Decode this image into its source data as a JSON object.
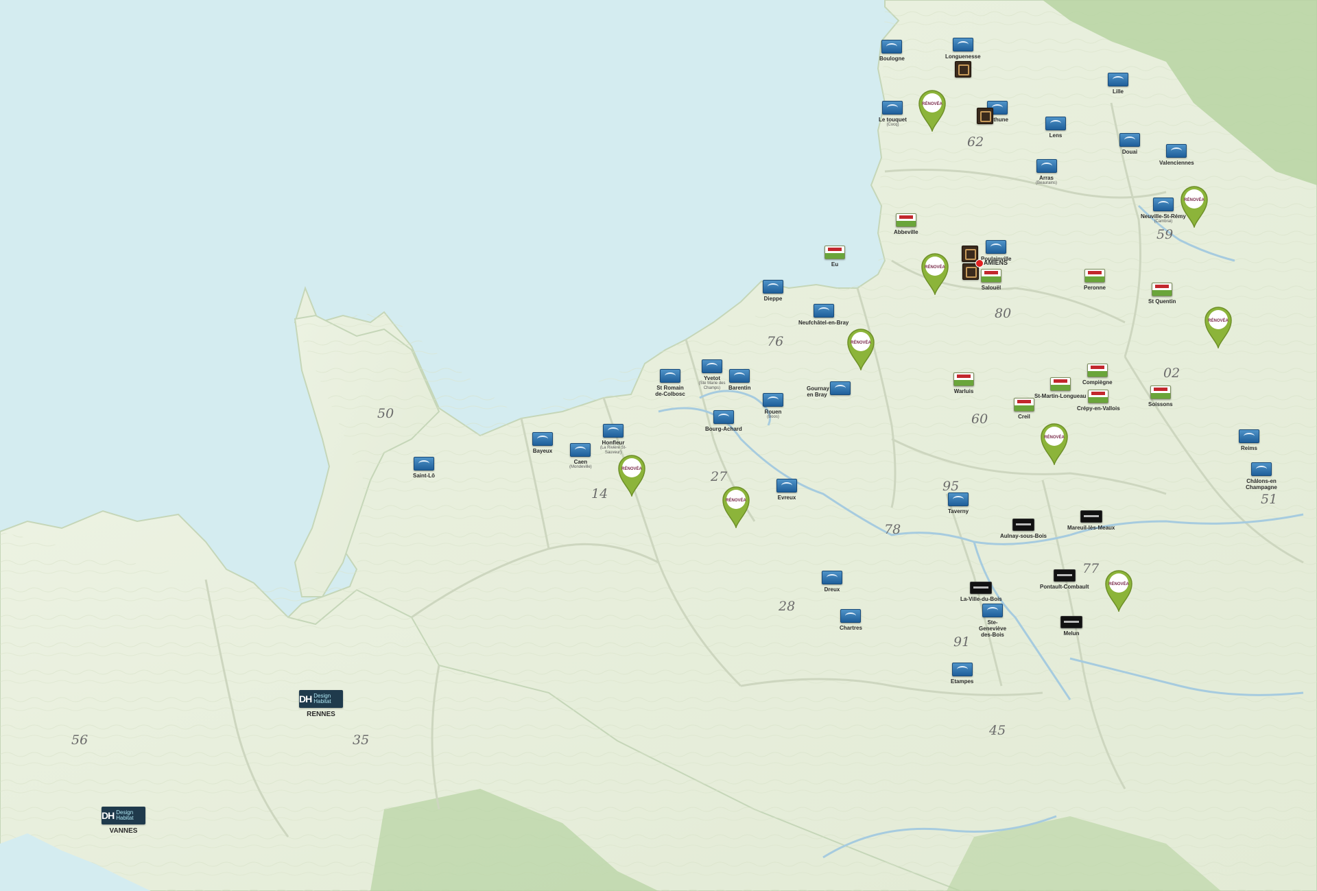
{
  "colors": {
    "sea": "#d4ecf0",
    "land": "#e7efdc",
    "land_shade": "#d9e4c9",
    "border": "#c9d3b9",
    "river": "#a6cbdf",
    "forest": "#b7d3a2",
    "pin_green": "#8cb43a",
    "dh_blue": "#1f3a4c",
    "amiens_red": "#e02020"
  },
  "departments": [
    "62",
    "59",
    "80",
    "02",
    "76",
    "60",
    "50",
    "14",
    "27",
    "95",
    "78",
    "77",
    "51",
    "28",
    "91",
    "56",
    "35",
    "45"
  ],
  "markers": [
    {
      "city": "Boulogne",
      "icon": "blue-house-badge-icon",
      "sub": ""
    },
    {
      "city": "Longuenesse",
      "icon": "blue-house-badge-icon",
      "sub": ""
    },
    {
      "city": "Lille",
      "icon": "blue-house-badge-icon",
      "sub": ""
    },
    {
      "city": "Le touquet",
      "icon": "blue-house-badge-icon",
      "sub": "(Cucq)"
    },
    {
      "city": "Bethune",
      "icon": "blue-house-badge-icon",
      "sub": ""
    },
    {
      "city": "Lens",
      "icon": "blue-house-badge-icon",
      "sub": ""
    },
    {
      "city": "Douai",
      "icon": "blue-house-badge-icon",
      "sub": ""
    },
    {
      "city": "Valenciennes",
      "icon": "blue-house-badge-icon",
      "sub": ""
    },
    {
      "city": "Arras",
      "icon": "blue-house-badge-icon",
      "sub": "(Beaurains)"
    },
    {
      "city": "Neuville-St-Rémy",
      "icon": "blue-house-badge-icon",
      "sub": "(Cambrai)"
    },
    {
      "city": "Abbeville",
      "icon": "green-picardie-badge-icon",
      "sub": ""
    },
    {
      "city": "Eu",
      "icon": "green-picardie-badge-icon",
      "sub": ""
    },
    {
      "city": "Poulainville",
      "icon": "blue-house-badge-icon",
      "sub": ""
    },
    {
      "city": "Salouël",
      "icon": "green-picardie-badge-icon",
      "sub": ""
    },
    {
      "city": "Peronne",
      "icon": "green-picardie-badge-icon",
      "sub": ""
    },
    {
      "city": "St Quentin",
      "icon": "green-picardie-badge-icon",
      "sub": ""
    },
    {
      "city": "Dieppe",
      "icon": "blue-house-badge-icon",
      "sub": ""
    },
    {
      "city": "Neufchâtel-en-Bray",
      "icon": "blue-house-badge-icon",
      "sub": ""
    },
    {
      "city": "St Romain de-Colbosc",
      "icon": "blue-house-badge-icon",
      "sub": ""
    },
    {
      "city": "Yvetot",
      "icon": "blue-house-badge-icon",
      "sub": "(Ste Marie des Champs)"
    },
    {
      "city": "Barentin",
      "icon": "blue-house-badge-icon",
      "sub": ""
    },
    {
      "city": "Rouen",
      "icon": "blue-house-badge-icon",
      "sub": "(Boos)"
    },
    {
      "city": "Gournay en Bray",
      "icon": "blue-house-badge-icon",
      "sub": ""
    },
    {
      "city": "Bourg-Achard",
      "icon": "blue-house-badge-icon",
      "sub": ""
    },
    {
      "city": "Warluis",
      "icon": "green-picardie-badge-icon",
      "sub": ""
    },
    {
      "city": "St-Martin-Longueau",
      "icon": "green-picardie-badge-icon",
      "sub": ""
    },
    {
      "city": "Compiègne",
      "icon": "green-picardie-badge-icon",
      "sub": ""
    },
    {
      "city": "Crépy-en-Vallois",
      "icon": "green-picardie-badge-icon",
      "sub": ""
    },
    {
      "city": "Creil",
      "icon": "green-picardie-badge-icon",
      "sub": ""
    },
    {
      "city": "Soissons",
      "icon": "green-picardie-badge-icon",
      "sub": ""
    },
    {
      "city": "Bayeux",
      "icon": "blue-house-badge-icon",
      "sub": ""
    },
    {
      "city": "Caen",
      "icon": "blue-house-badge-icon",
      "sub": "(Mondeville)"
    },
    {
      "city": "Honfleur",
      "icon": "blue-house-badge-icon",
      "sub": "(La Rivière St-Sauveur)"
    },
    {
      "city": "Saint-Lô",
      "icon": "blue-house-badge-icon",
      "sub": ""
    },
    {
      "city": "Evreux",
      "icon": "blue-house-badge-icon",
      "sub": ""
    },
    {
      "city": "Taverny",
      "icon": "blue-house-badge-icon",
      "sub": ""
    },
    {
      "city": "Aulnay-sous-Bois",
      "icon": "black-store-badge-icon",
      "sub": ""
    },
    {
      "city": "Mareuil-lès-Meaux",
      "icon": "black-store-badge-icon",
      "sub": ""
    },
    {
      "city": "Reims",
      "icon": "blue-house-badge-icon",
      "sub": ""
    },
    {
      "city": "Châlons-en Champagne",
      "icon": "blue-house-badge-icon",
      "sub": ""
    },
    {
      "city": "Dreux",
      "icon": "blue-house-badge-icon",
      "sub": ""
    },
    {
      "city": "Chartres",
      "icon": "blue-house-badge-icon",
      "sub": ""
    },
    {
      "city": "La-Ville-du-Bois",
      "icon": "black-store-badge-icon",
      "sub": ""
    },
    {
      "city": "Ste-Geneviève des-Bois",
      "icon": "blue-house-badge-icon",
      "sub": ""
    },
    {
      "city": "Pontault-Combault",
      "icon": "black-store-badge-icon",
      "sub": ""
    },
    {
      "city": "Melun",
      "icon": "black-store-badge-icon",
      "sub": ""
    },
    {
      "city": "Etampes",
      "icon": "blue-house-badge-icon",
      "sub": ""
    }
  ],
  "amiens": {
    "city": "AMIENS",
    "icon": "red-dot-icon"
  },
  "renovea_pins": [
    {
      "label": "RÉNOVÉA",
      "icon": "map-pin-icon"
    },
    {
      "label": "RÉNOVÉA",
      "icon": "map-pin-icon"
    },
    {
      "label": "RÉNOVÉA",
      "icon": "map-pin-icon"
    },
    {
      "label": "RÉNOVÉA",
      "icon": "map-pin-icon"
    },
    {
      "label": "RÉNOVÉA",
      "icon": "map-pin-icon"
    },
    {
      "label": "RÉNOVÉA",
      "icon": "map-pin-icon"
    },
    {
      "label": "RÉNOVÉA",
      "icon": "map-pin-icon"
    },
    {
      "label": "RÉNOVÉA",
      "icon": "map-pin-icon"
    },
    {
      "label": "RÉNOVÉA",
      "icon": "map-pin-icon"
    }
  ],
  "design_habitat": [
    {
      "city": "RENNES",
      "logo_main": "DH",
      "logo_text": "Design Habitat"
    },
    {
      "city": "VANNES",
      "logo_main": "DH",
      "logo_text": "Design Habitat"
    }
  ]
}
